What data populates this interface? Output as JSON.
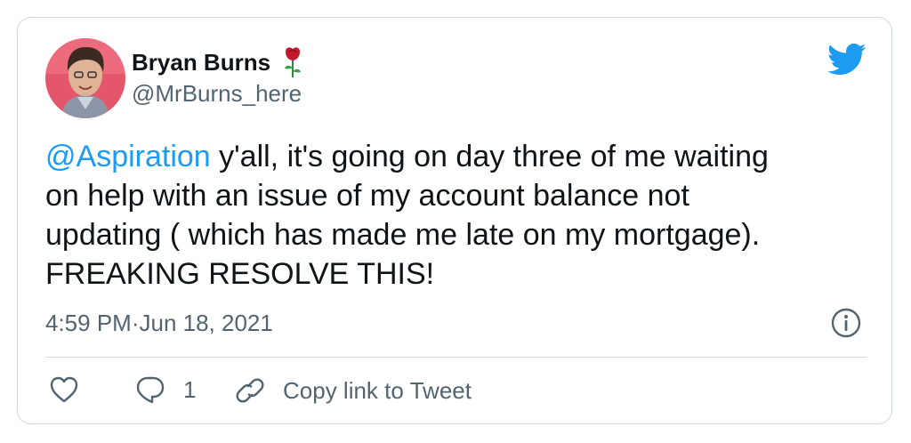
{
  "author": {
    "name": "Bryan Burns",
    "handle": "@MrBurns_here"
  },
  "tweet": {
    "mention": "@Aspiration",
    "body": " y'all, it's going on day three of me waiting\non help with an issue of my account balance not\nupdating ( which has made me late on my mortgage).\nFREAKING RESOLVE THIS!",
    "time": "4:59 PM",
    "separator": " · ",
    "date": "Jun 18, 2021"
  },
  "actions": {
    "reply_count": "1",
    "copy_link_label": "Copy link to Tweet"
  },
  "icons": {
    "avatar": "avatar-photo",
    "emoji": "rose-icon",
    "brand": "twitter-bird-icon",
    "info": "info-icon",
    "like": "heart-icon",
    "reply": "reply-bubble-icon",
    "link": "link-icon"
  },
  "colors": {
    "accent": "#1d9bf0",
    "text": "#0f1419",
    "muted": "#536471",
    "border": "#cfd9de",
    "avatar_bg": "#e4576a"
  }
}
